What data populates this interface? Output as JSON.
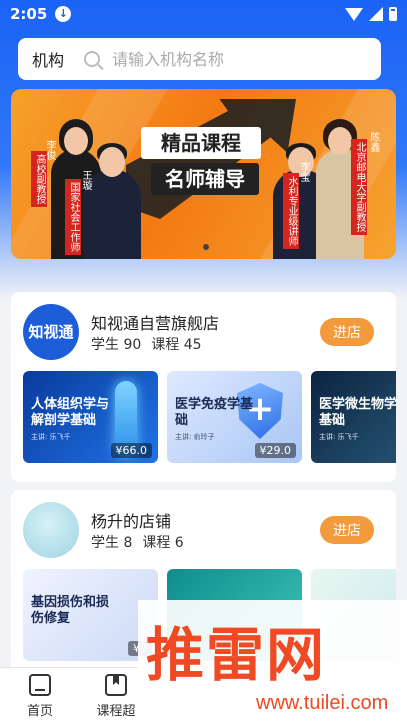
{
  "status_bar": {
    "time": "2:05"
  },
  "search": {
    "scope_label": "机构",
    "placeholder": "请输入机构名称"
  },
  "banner": {
    "title_line1": "精品课程",
    "title_line2": "名师辅导",
    "teachers": [
      {
        "name": "李俊",
        "title": "高校副教授"
      },
      {
        "name": "王璇",
        "title": "国家社会工作师"
      },
      {
        "name": "李宝",
        "title": "水利专业级讲师"
      },
      {
        "name": "陈鑫",
        "title": "北京邮电大学副教授"
      }
    ]
  },
  "stores": [
    {
      "logo_text": "知视通",
      "name": "知视通自营旗舰店",
      "students_label": "学生 90",
      "courses_label": "课程 45",
      "enter_label": "进店",
      "courses": [
        {
          "title": "人体组织学与解剖学基础",
          "teacher": "主讲: 乐飞千",
          "price": "¥66.0"
        },
        {
          "title": "医学免疫学基础",
          "teacher": "主讲: 俞玲子",
          "price": "¥29.0"
        },
        {
          "title": "医学微生物学基础",
          "teacher": "主讲: 乐飞千",
          "price": ""
        }
      ]
    },
    {
      "logo_text": "",
      "name": "杨升的店铺",
      "students_label": "学生 8",
      "courses_label": "课程 6",
      "enter_label": "进店",
      "courses": [
        {
          "title": "基因损伤和损伤修复",
          "teacher": "",
          "price": "¥9"
        },
        {
          "title": "",
          "teacher": "",
          "price": ""
        },
        {
          "title": "",
          "teacher": "",
          "price": ""
        }
      ]
    }
  ],
  "tabbar": {
    "items": [
      {
        "label": "首页"
      },
      {
        "label": "课程超"
      }
    ]
  },
  "watermark": {
    "text": "推雷网",
    "url": "www.tuilei.com"
  }
}
